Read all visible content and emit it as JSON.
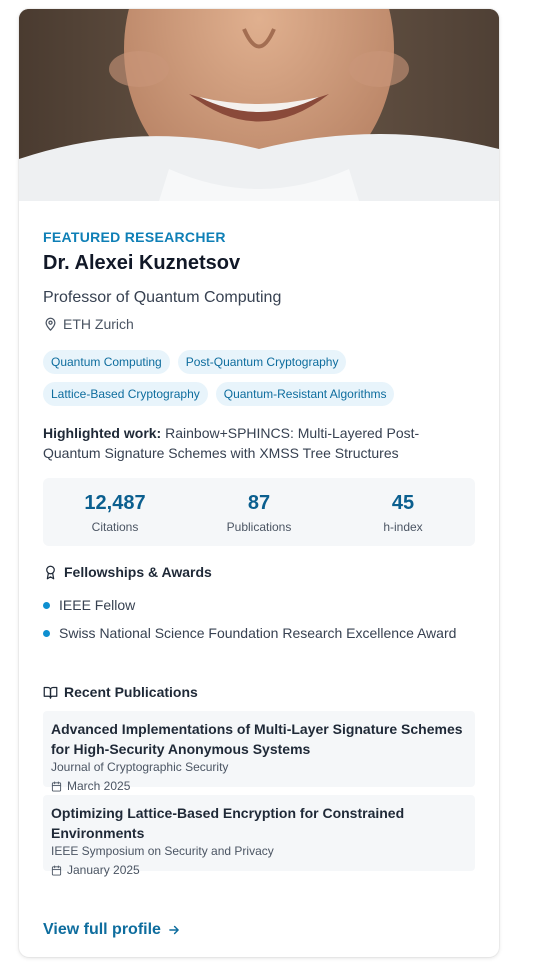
{
  "header": {
    "eyebrow": "FEATURED RESEARCHER"
  },
  "researcher": {
    "name": "Dr. Alexei Kuznetsov",
    "title": "Professor of Quantum Computing",
    "institution": "ETH Zurich"
  },
  "tags": [
    "Quantum Computing",
    "Post-Quantum Cryptography",
    "Lattice-Based Cryptography",
    "Quantum-Resistant Algorithms"
  ],
  "highlighted": {
    "label": "Highlighted work:",
    "text": "Rainbow+SPHINCS: Multi-Layered Post-Quantum Signature Schemes with XMSS Tree Structures"
  },
  "stats": [
    {
      "value": "12,487",
      "label": "Citations"
    },
    {
      "value": "87",
      "label": "Publications"
    },
    {
      "value": "45",
      "label": "h-index"
    }
  ],
  "awards": {
    "heading": "Fellowships & Awards",
    "items": [
      "IEEE Fellow",
      "Swiss National Science Foundation Research Excellence Award"
    ]
  },
  "publications": {
    "heading": "Recent Publications",
    "items": [
      {
        "title": "Advanced Implementations of Multi-Layer Signature Schemes for High-Security Anonymous Systems",
        "venue": "Journal of Cryptographic Security",
        "date": "March 2025"
      },
      {
        "title": "Optimizing Lattice-Based Encryption for Constrained Environments",
        "venue": "IEEE Symposium on Security and Privacy",
        "date": "January 2025"
      }
    ]
  },
  "cta": {
    "label": "View full profile"
  },
  "colors": {
    "accent": "#0e7fb6",
    "statNumber": "#0b5f8f",
    "tagBg": "#e8f4fb",
    "bullet": "#0e8fd0"
  },
  "icons": {
    "location": "map-pin-icon",
    "award": "award-icon",
    "book": "book-open-icon",
    "calendar": "calendar-icon",
    "arrow": "arrow-right-icon"
  }
}
